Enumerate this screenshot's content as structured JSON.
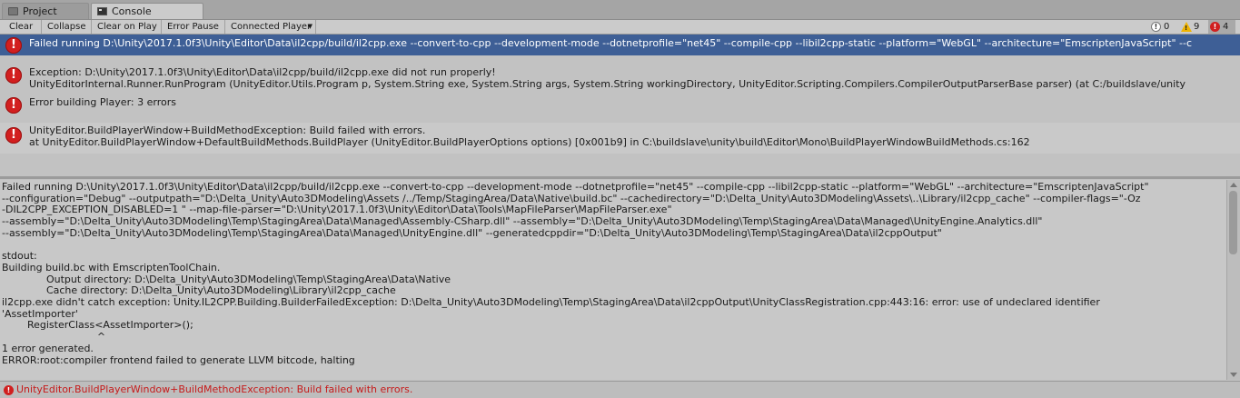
{
  "tabs": [
    {
      "label": "Project",
      "icon": "project-icon"
    },
    {
      "label": "Console",
      "icon": "console-icon",
      "active": true
    }
  ],
  "toolbar": {
    "clear": "Clear",
    "collapse": "Collapse",
    "clear_on_play": "Clear on Play",
    "error_pause": "Error Pause",
    "connected_player": "Connected Player",
    "counts": {
      "info": "0",
      "warnings": "9",
      "errors": "4"
    }
  },
  "entries": [
    {
      "icon": "error-icon",
      "lines": [
        "Failed running D:\\Unity\\2017.1.0f3\\Unity\\Editor\\Data\\il2cpp/build/il2cpp.exe --convert-to-cpp --development-mode --dotnetprofile=\"net45\" --compile-cpp --libil2cpp-static --platform=\"WebGL\" --architecture=\"EmscriptenJavaScript\" --c"
      ],
      "selected": true
    },
    {
      "icon": "error-icon",
      "lines": [
        "Exception: D:\\Unity\\2017.1.0f3\\Unity\\Editor\\Data\\il2cpp/build/il2cpp.exe did not run properly!",
        "UnityEditorInternal.Runner.RunProgram (UnityEditor.Utils.Program p, System.String exe, System.String args, System.String workingDirectory, UnityEditor.Scripting.Compilers.CompilerOutputParserBase parser) (at C:/buildslave/unity"
      ]
    },
    {
      "icon": "error-icon",
      "lines": [
        "Error building Player: 3 errors"
      ]
    },
    {
      "icon": "error-icon",
      "lines": [
        "UnityEditor.BuildPlayerWindow+BuildMethodException: Build failed with errors.",
        "  at UnityEditor.BuildPlayerWindow+DefaultBuildMethods.BuildPlayer (UnityEditor.BuildPlayerOptions options) [0x001b9] in C:\\buildslave\\unity\\build\\Editor\\Mono\\BuildPlayerWindowBuildMethods.cs:162"
      ]
    }
  ],
  "detail": {
    "text": "Failed running D:\\Unity\\2017.1.0f3\\Unity\\Editor\\Data\\il2cpp/build/il2cpp.exe --convert-to-cpp --development-mode --dotnetprofile=\"net45\" --compile-cpp --libil2cpp-static --platform=\"WebGL\" --architecture=\"EmscriptenJavaScript\"\n--configuration=\"Debug\" --outputpath=\"D:\\Delta_Unity\\Auto3DModeling\\Assets /../Temp/StagingArea/Data\\Native\\build.bc\" --cachedirectory=\"D:\\Delta_Unity\\Auto3DModeling\\Assets\\..\\Library/il2cpp_cache\" --compiler-flags=\"-Oz\n-DIL2CPP_EXCEPTION_DISABLED=1 \" --map-file-parser=\"D:\\Unity\\2017.1.0f3\\Unity\\Editor\\Data\\Tools\\MapFileParser\\MapFileParser.exe\"\n--assembly=\"D:\\Delta_Unity\\Auto3DModeling\\Temp\\StagingArea\\Data\\Managed\\Assembly-CSharp.dll\" --assembly=\"D:\\Delta_Unity\\Auto3DModeling\\Temp\\StagingArea\\Data\\Managed\\UnityEngine.Analytics.dll\"\n--assembly=\"D:\\Delta_Unity\\Auto3DModeling\\Temp\\StagingArea\\Data\\Managed\\UnityEngine.dll\" --generatedcppdir=\"D:\\Delta_Unity\\Auto3DModeling\\Temp\\StagingArea\\Data\\il2cppOutput\"\n\nstdout:\nBuilding build.bc with EmscriptenToolChain.\n              Output directory: D:\\Delta_Unity\\Auto3DModeling\\Temp\\StagingArea\\Data\\Native\n              Cache directory: D:\\Delta_Unity\\Auto3DModeling\\Library\\il2cpp_cache\nil2cpp.exe didn't catch exception: Unity.IL2CPP.Building.BuilderFailedException: D:\\Delta_Unity\\Auto3DModeling\\Temp\\StagingArea\\Data\\il2cppOutput\\UnityClassRegistration.cpp:443:16: error: use of undeclared identifier\n'AssetImporter'\n        RegisterClass<AssetImporter>();\n                              ^\n1 error generated.\nERROR:root:compiler frontend failed to generate LLVM bitcode, halting"
  },
  "status": {
    "icon": "error-icon",
    "text": "UnityEditor.BuildPlayerWindow+BuildMethodException: Build failed with errors."
  },
  "colors": {
    "selection": "#3e5f96",
    "error": "#d21f1f",
    "status_text": "#c61b1b",
    "warning": "#f0b400"
  }
}
